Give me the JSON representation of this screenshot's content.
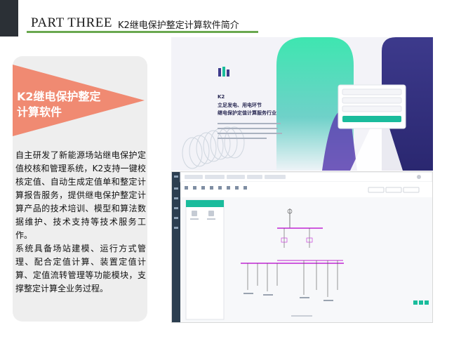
{
  "header": {
    "part": "PART THREE",
    "subtitle": "K2继电保护整定计算软件简介"
  },
  "tag": {
    "line1": "K2继电保护整定",
    "line2": "计算软件"
  },
  "description": {
    "paragraph1": "自主研发了新能源场站继电保护定值校核和管理系统，K2支持一键校核定值、自动生成定值单和整定计算报告服务，提供继电保护整定计算产品的技术培训、模型和算法数据维护、技术支持等技术服务工作。",
    "paragraph2": "系统具备场站建模、运行方式管理、配合定值计算、装置定值计算、定值流转管理等功能模块，支撑整定计算全业务过程。"
  },
  "login_screenshot": {
    "brand": "K2",
    "slogan_line1": "立足发电、用电环节",
    "slogan_line2": "继电保护定值计算服务行业"
  },
  "colors": {
    "accent_green": "#6aa84f",
    "tag_salmon": "#f08a72",
    "dark_block": "#2b3036",
    "app_sidebar": "#2c3e50",
    "teal": "#1abc9c",
    "purple": "#3d3a8c",
    "magenta": "#c026d3"
  }
}
